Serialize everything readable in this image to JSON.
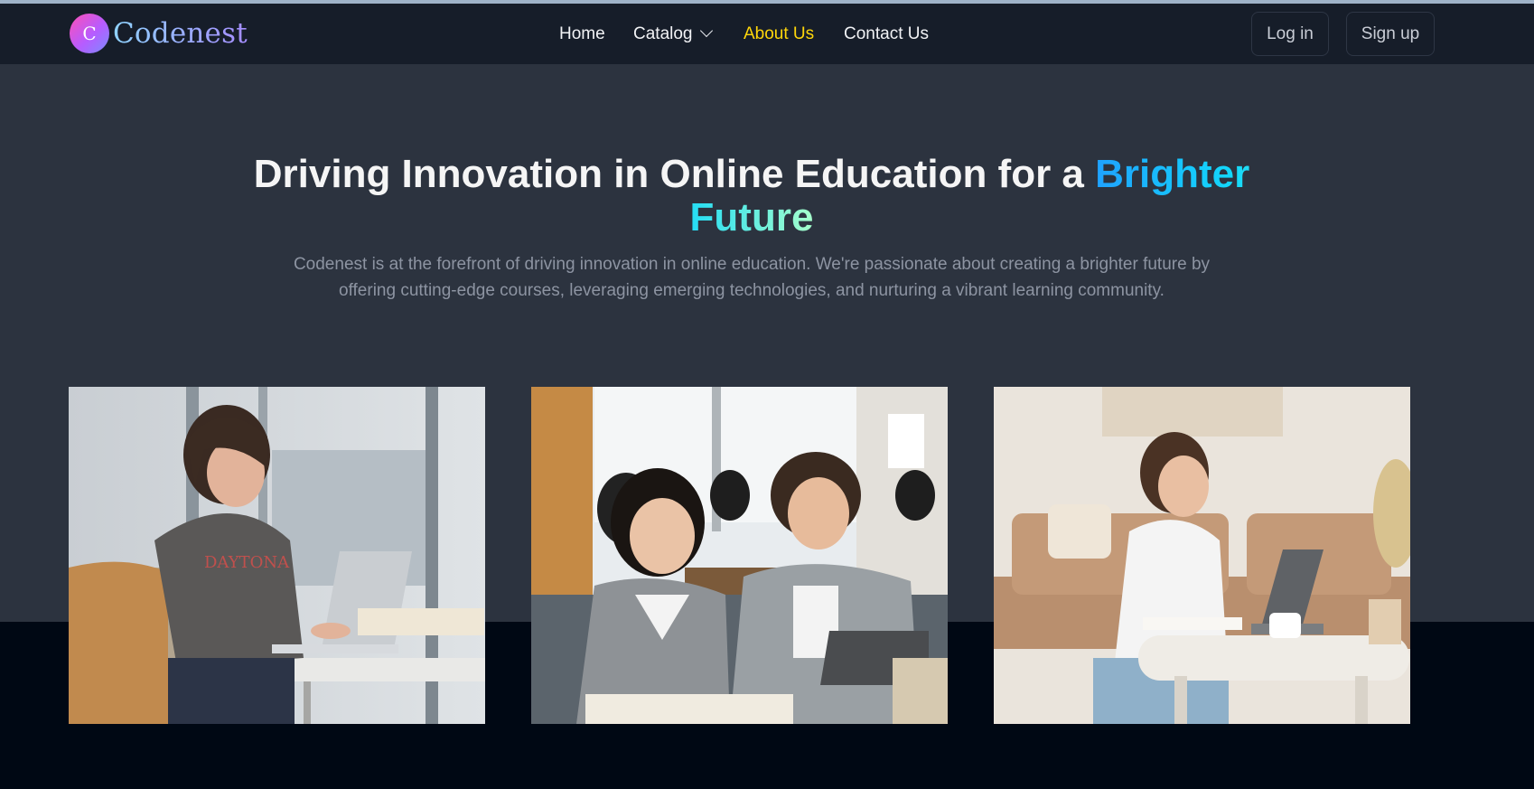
{
  "brand": {
    "logo_letter": "C",
    "name": "Codenest"
  },
  "nav": {
    "home": "Home",
    "catalog": "Catalog",
    "about": "About Us",
    "contact": "Contact Us"
  },
  "auth": {
    "login": "Log in",
    "signup": "Sign up"
  },
  "hero": {
    "title_main": "Driving Innovation in Online Education for a ",
    "title_highlight": "Brighter Future",
    "description": "Codenest is at the forefront of driving innovation in online education. We're passionate about creating a brighter future by offering cutting-edge courses, leveraging emerging technologies, and nurturing a vibrant learning community."
  },
  "images": [
    {
      "shirt_text": "DAYTONA"
    }
  ],
  "colors": {
    "navbar": "#161d29",
    "hero_bg": "#2c333f",
    "page_bg": "#000814",
    "active_link": "#ffd60a",
    "highlight_start": "#1fa2ff",
    "highlight_end": "#a6ffcb"
  }
}
